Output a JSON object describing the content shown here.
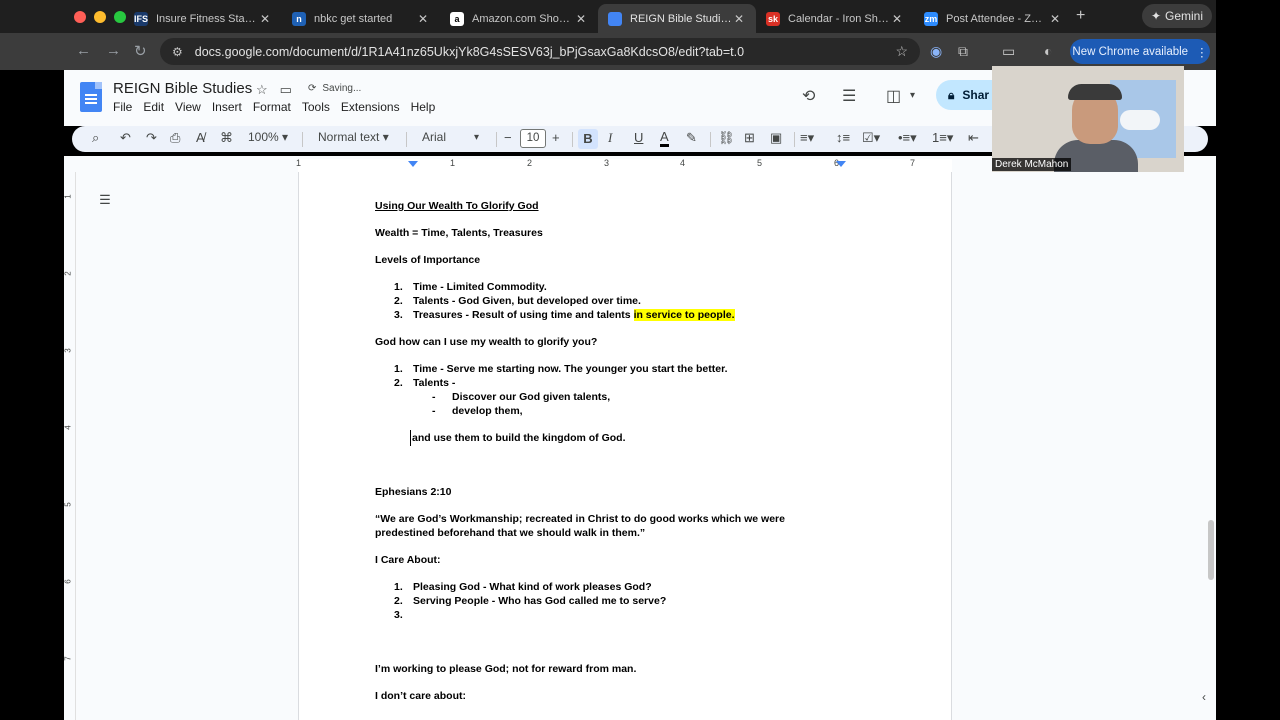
{
  "browser": {
    "traffic_colors": [
      "#ff5f57",
      "#febc2e",
      "#28c840"
    ],
    "tabs": [
      {
        "favicon_text": "IFS",
        "favicon_color": "#1a3a6b",
        "title": "Insure Fitness Standar"
      },
      {
        "favicon_text": "n",
        "favicon_color": "#1f61b5",
        "title": "nbkc get started"
      },
      {
        "favicon_text": "a",
        "favicon_color": "#ffffff",
        "title": "Amazon.com Shopping"
      },
      {
        "favicon_text": "",
        "favicon_color": "#4285f4",
        "title": "REIGN Bible Studies -"
      },
      {
        "favicon_text": "sk",
        "favicon_color": "#d93025",
        "title": "Calendar - Iron Sharpe"
      },
      {
        "favicon_text": "zm",
        "favicon_color": "#2d8cff",
        "title": "Post Attendee - Zoom"
      }
    ],
    "active_tab_index": 3,
    "new_tab": "+",
    "gemini_label": "Gemini",
    "url": "docs.google.com/document/d/1R1A41nz65UkxjYk8G4sSESV63j_bPjGsaxGa8KdcsO8/edit?tab=t.0",
    "update_label": "New Chrome available"
  },
  "docs": {
    "title": "REIGN Bible Studies",
    "saving": "Saving...",
    "menu": [
      "File",
      "Edit",
      "View",
      "Insert",
      "Format",
      "Tools",
      "Extensions",
      "Help"
    ],
    "share_label": "Shar",
    "toolbar": {
      "zoom": "100%",
      "style": "Normal text",
      "font": "Arial",
      "font_size": "10"
    },
    "ruler_numbers": [
      "1",
      "1",
      "2",
      "3",
      "4",
      "5",
      "6",
      "7"
    ],
    "vruler_numbers": [
      "1",
      "2",
      "3",
      "4",
      "5",
      "6",
      "7"
    ]
  },
  "document": {
    "heading": "Using Our Wealth To Glorify God",
    "wealth_line": "Wealth = Time, Talents, Treasures",
    "levels_heading": "Levels of Importance",
    "levels": [
      {
        "n": "1.",
        "text": "Time - Limited Commodity.",
        "highlight": ""
      },
      {
        "n": "2.",
        "text": "Talents - God Given, but developed over time.",
        "highlight": ""
      },
      {
        "n": "3.",
        "text": "Treasures - Result of using time and talents ",
        "highlight": "in service to people."
      }
    ],
    "question": "God how can I use my wealth to glorify you?",
    "answers": [
      {
        "n": "1.",
        "text": "Time - Serve me starting now. The younger you start the better."
      },
      {
        "n": "2.",
        "text": "Talents -"
      }
    ],
    "talent_subs": [
      {
        "n": "-",
        "text": "Discover our God given talents,"
      },
      {
        "n": "-",
        "text": "develop them,"
      }
    ],
    "use_line": "and use them to build the kingdom of God.",
    "verse_ref": "Ephesians 2:10",
    "verse_line1": "“We are God’s Workmanship; recreated in Christ to do good works which we were",
    "verse_line2": "predestined beforehand that we should walk in them.”",
    "care_heading": "I Care About:",
    "cares": [
      {
        "n": "1.",
        "text": "Pleasing God - What kind of work pleases God?"
      },
      {
        "n": "2.",
        "text": "Serving People - Who has God called me to serve?"
      },
      {
        "n": "3.",
        "text": ""
      }
    ],
    "working_line": "I’m working to please God; not for reward from man.",
    "dont_care_heading": "I don’t care about:"
  },
  "video": {
    "participant": "Derek McMahon"
  }
}
